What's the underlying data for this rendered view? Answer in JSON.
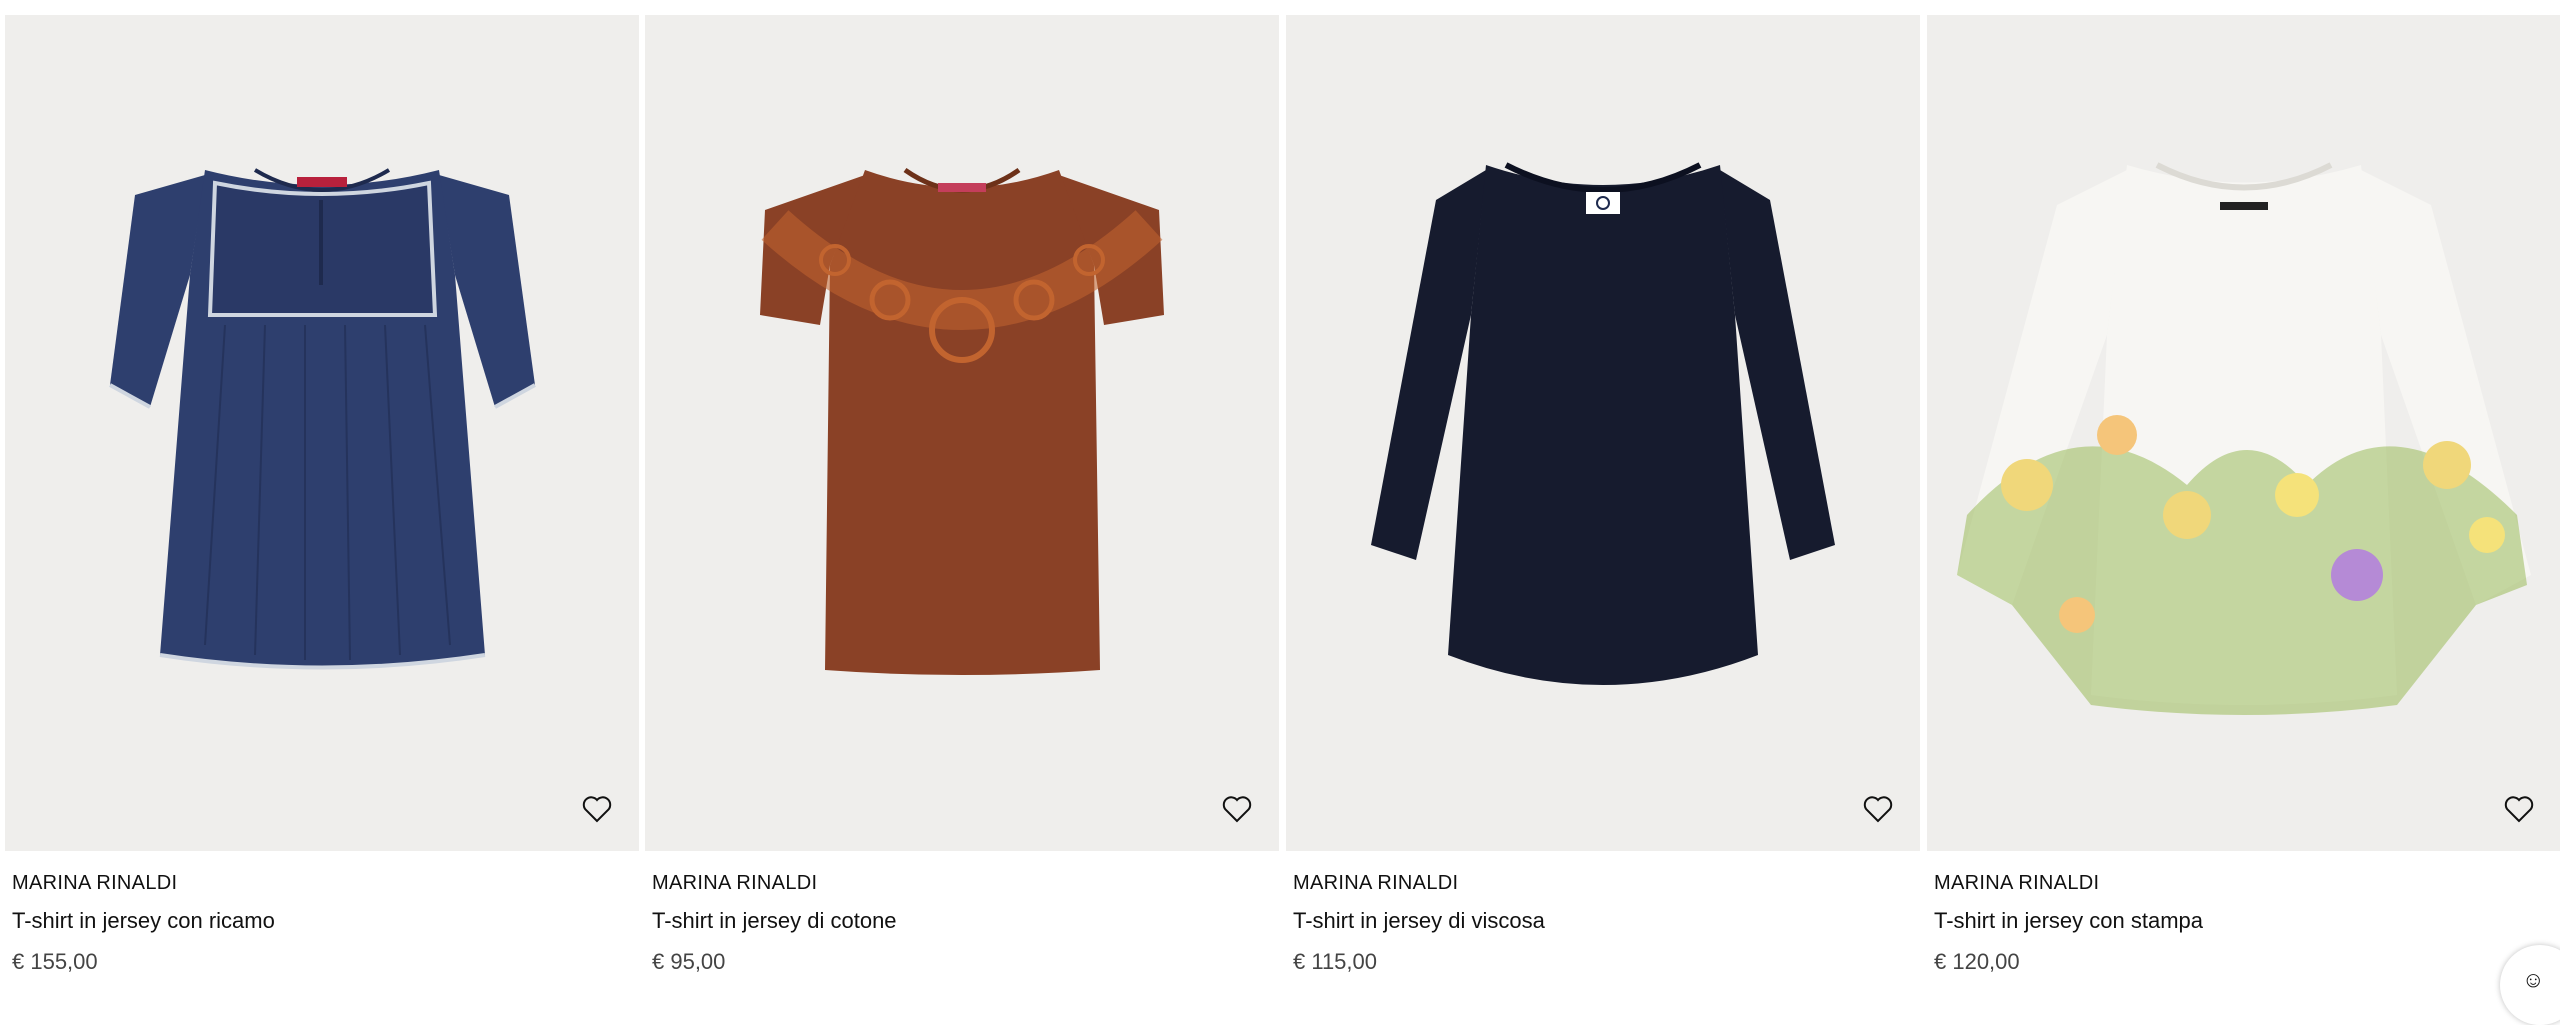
{
  "products": [
    {
      "brand": "MARINA RINALDI",
      "title": "T-shirt in jersey con ricamo",
      "price": "€ 155,00",
      "color_name": "navy",
      "color": "#2e3f6e",
      "wishlist_icon": "heart-outline-icon"
    },
    {
      "brand": "MARINA RINALDI",
      "title": "T-shirt in jersey di cotone",
      "price": "€ 95,00",
      "color_name": "rust",
      "color": "#8a4126",
      "wishlist_icon": "heart-outline-icon"
    },
    {
      "brand": "MARINA RINALDI",
      "title": "T-shirt in jersey di viscosa",
      "price": "€ 115,00",
      "color_name": "dark navy",
      "color": "#161b2e",
      "wishlist_icon": "heart-outline-icon"
    },
    {
      "brand": "MARINA RINALDI",
      "title": "T-shirt in jersey con stampa",
      "price": "€ 120,00",
      "color_name": "white floral",
      "color": "#f7f6f3",
      "wishlist_icon": "heart-outline-icon"
    }
  ],
  "colors": {
    "image_background": "#efeeec",
    "text": "#111111",
    "price_text": "#444444"
  }
}
